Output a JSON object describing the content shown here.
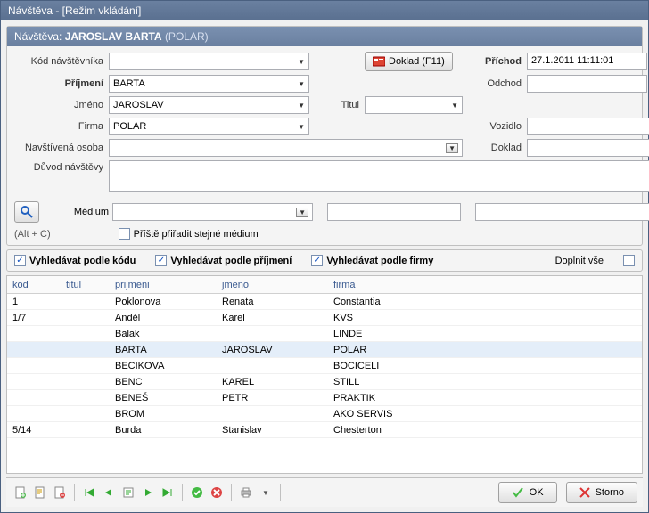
{
  "window_title": "Návštěva - [Režim vkládání]",
  "header": {
    "label": "Návštěva:",
    "name": "JAROSLAV BARTA",
    "firm": "(POLAR)"
  },
  "form": {
    "visitor_code_label": "Kód návštěvníka",
    "visitor_code": "",
    "surname_label": "Příjmení",
    "surname": "BARTA",
    "firstname_label": "Jméno",
    "firstname": "JAROSLAV",
    "title_label": "Titul",
    "title": "",
    "company_label": "Firma",
    "company": "POLAR",
    "visited_person_label": "Navštívená osoba",
    "visited_person": "",
    "reason_label": "Důvod návštěvy",
    "reason": "",
    "doklad_button": "Doklad (F11)",
    "arrival_label": "Příchod",
    "arrival": "27.1.2011 11:11:01",
    "departure_label": "Odchod",
    "departure": "",
    "vehicle_label": "Vozidlo",
    "vehicle": "",
    "document_label": "Doklad",
    "document": ""
  },
  "media": {
    "label": "Médium",
    "value": "",
    "extra1": "",
    "extra2": "",
    "hint": "(Alt + C)",
    "assign_same_label": "Příště přiřadit stejné médium",
    "assign_same_checked": false
  },
  "search": {
    "by_code_label": "Vyhledávat podle kódu",
    "by_code_checked": true,
    "by_surname_label": "Vyhledávat podle příjmení",
    "by_surname_checked": true,
    "by_company_label": "Vyhledávat podle firmy",
    "by_company_checked": true,
    "fill_all_label": "Doplnit vše",
    "fill_all_checked": false
  },
  "grid": {
    "columns": {
      "kod": "kod",
      "titul": "titul",
      "prijmeni": "prijmeni",
      "jmeno": "jmeno",
      "firma": "firma"
    },
    "rows": [
      {
        "kod": "1",
        "titul": "",
        "prijmeni": "Poklonova",
        "jmeno": "Renata",
        "firma": "Constantia"
      },
      {
        "kod": "1/7",
        "titul": "",
        "prijmeni": "Anděl",
        "jmeno": "Karel",
        "firma": "KVS"
      },
      {
        "kod": "",
        "titul": "",
        "prijmeni": "Balak",
        "jmeno": "",
        "firma": "LINDE"
      },
      {
        "kod": "",
        "titul": "",
        "prijmeni": "BARTA",
        "jmeno": "JAROSLAV",
        "firma": "POLAR",
        "selected": true
      },
      {
        "kod": "",
        "titul": "",
        "prijmeni": "BECIKOVA",
        "jmeno": "",
        "firma": "BOCICELI"
      },
      {
        "kod": "",
        "titul": "",
        "prijmeni": "BENC",
        "jmeno": "KAREL",
        "firma": "STILL"
      },
      {
        "kod": "",
        "titul": "",
        "prijmeni": "BENEŠ",
        "jmeno": "PETR",
        "firma": "PRAKTIK"
      },
      {
        "kod": "",
        "titul": "",
        "prijmeni": "BROM",
        "jmeno": "",
        "firma": "AKO SERVIS"
      },
      {
        "kod": "5/14",
        "titul": "",
        "prijmeni": "Burda",
        "jmeno": "Stanislav",
        "firma": "Chesterton"
      }
    ]
  },
  "buttons": {
    "ok": "OK",
    "storno": "Storno"
  }
}
